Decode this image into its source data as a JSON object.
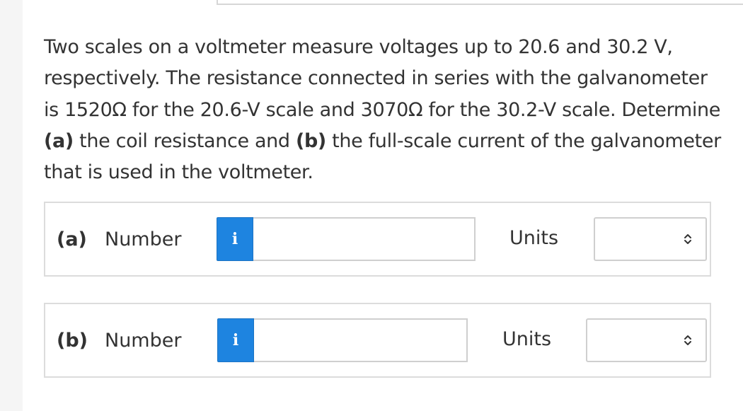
{
  "question": {
    "line1_text": "Two scales on a voltmeter measure voltages up to 20.6 and 30.2 V, respectively. The resistance connected in series with the galvanometer is 1520Ω for the 20.6-V scale and 3070Ω for the 30.2-V scale. Determine ",
    "part_a_marker": "(a)",
    "part_a_text": " the coil resistance and ",
    "part_b_marker": "(b)",
    "part_b_text": " the full-scale current of the galvanometer that is used in the voltmeter."
  },
  "parts": [
    {
      "letter": "(a)",
      "number_label": "Number",
      "info_icon": "i",
      "number_value": "",
      "units_label": "Units",
      "units_value": ""
    },
    {
      "letter": "(b)",
      "number_label": "Number",
      "info_icon": "i",
      "number_value": "",
      "units_label": "Units",
      "units_value": ""
    }
  ],
  "colors": {
    "info_button": "#1e84e0",
    "border": "#dcdcdc",
    "text": "#333333"
  }
}
